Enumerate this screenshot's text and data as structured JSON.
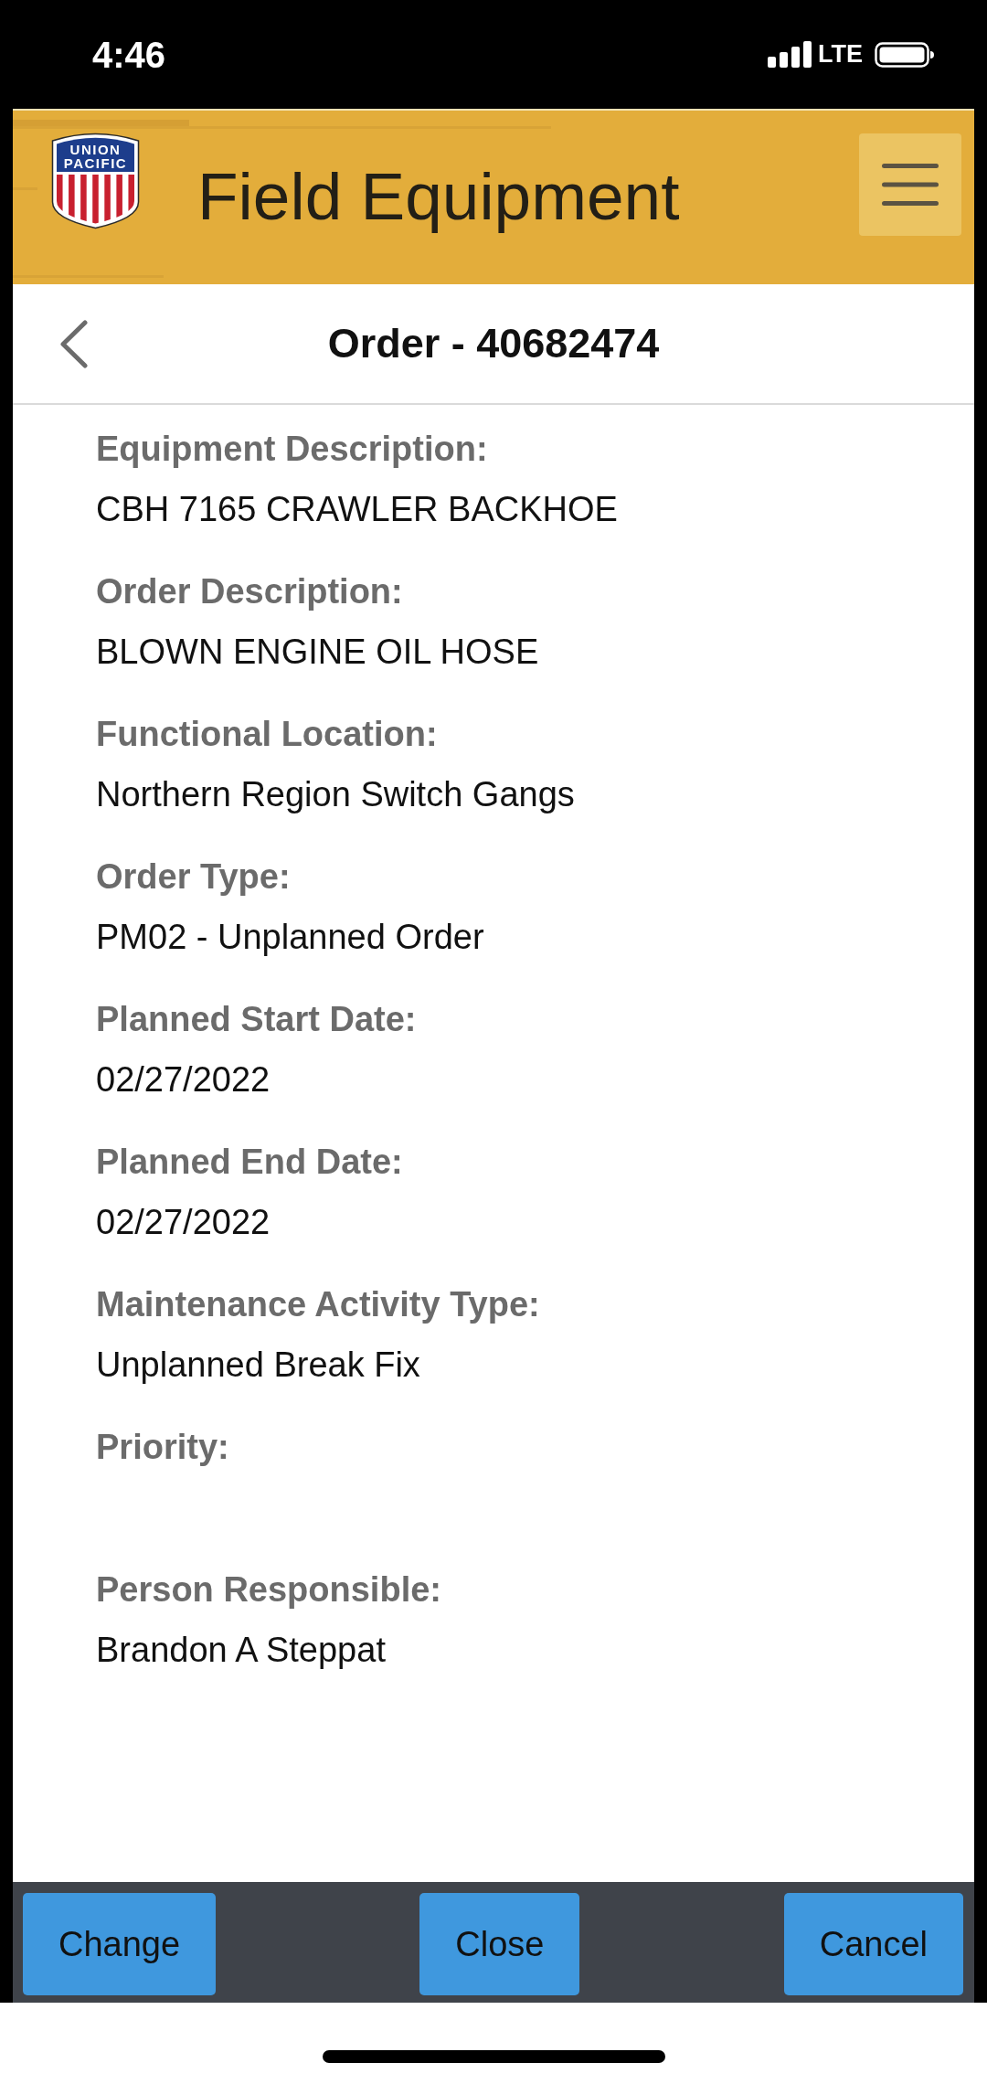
{
  "status_bar": {
    "time": "4:46",
    "network": "LTE"
  },
  "header": {
    "logo_lines": [
      "UNION",
      "PACIFIC"
    ],
    "title": "Field Equipment"
  },
  "nav": {
    "title": "Order - 40682474"
  },
  "fields": [
    {
      "label": "Equipment Description:",
      "value": "CBH 7165 CRAWLER BACKHOE"
    },
    {
      "label": "Order Description:",
      "value": "BLOWN ENGINE OIL HOSE"
    },
    {
      "label": "Functional Location:",
      "value": "Northern Region Switch Gangs"
    },
    {
      "label": "Order Type:",
      "value": "PM02 - Unplanned Order"
    },
    {
      "label": "Planned Start Date:",
      "value": "02/27/2022"
    },
    {
      "label": "Planned End Date:",
      "value": "02/27/2022"
    },
    {
      "label": "Maintenance Activity Type:",
      "value": "Unplanned Break Fix"
    },
    {
      "label": "Priority:"
    },
    {
      "label": "Person Responsible:",
      "value": "Brandon A Steppat"
    }
  ],
  "toolbar": {
    "buttons": [
      "Change",
      "Close",
      "Cancel"
    ]
  }
}
